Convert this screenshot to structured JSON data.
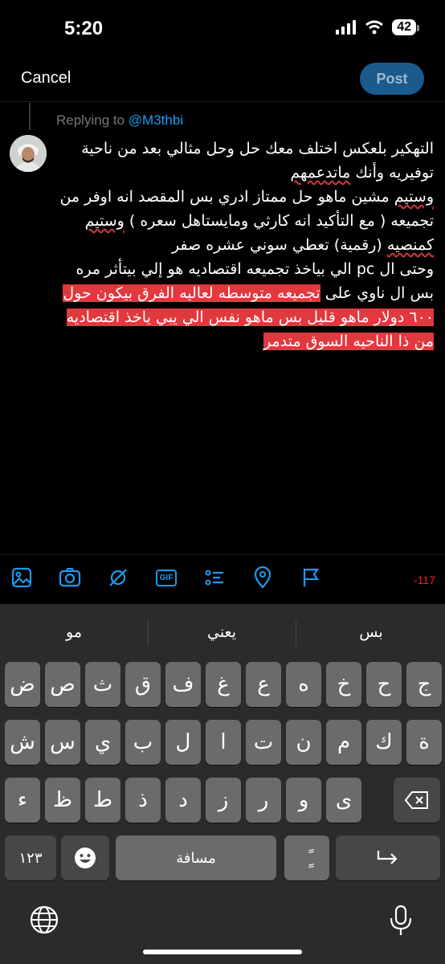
{
  "status": {
    "time": "5:20",
    "battery": "42"
  },
  "header": {
    "cancel_label": "Cancel",
    "post_label": "Post"
  },
  "reply": {
    "prefix": "Replying to",
    "handle": "@M3thbi"
  },
  "compose": {
    "p1": "التهكير بلعكس اختلف معك حل وحل مثالي بعد من ناحية توفيريه وأنك ",
    "p1_flag": "ماتدعمهم",
    "p2a_flag": "وستيم",
    "p2a": " مشين ماهو حل ممتاز ادري بس المقصد انه اوفر من تجميعه ( مع التأكيد انه كارثي ومايستاهل سعره ) ",
    "p2b_flag": "وستيم",
    "p2b_mid": " ",
    "p2c_flag": "كمنصيه",
    "p2c": " (رقمية) تعطي سوني عشره صفر",
    "p3_plain": "وحتى ال pc الي بياخذ تجميعه اقتصاديه هو إلي بيتأثر مره بس ال ناوي على ",
    "p3_highlight": "تجميعه متوسطه لعاليه الفرق بيكون حول ٦٠٠ دولار ماهو قليل بس ماهو نفس الي يبي ياخذ اقتصاديه من ذا الناحيه السوق متدمر"
  },
  "toolbar": {
    "icons": [
      "image-icon",
      "camera-icon",
      "grok-icon",
      "gif-icon",
      "poll-icon",
      "location-icon",
      "flag-icon"
    ],
    "gif_text": "GIF",
    "char_count": "-117"
  },
  "keyboard": {
    "suggestions": [
      "مو",
      "يعني",
      "بس"
    ],
    "row1": [
      "ض",
      "ص",
      "ث",
      "ق",
      "ف",
      "غ",
      "ع",
      "ه",
      "خ",
      "ح",
      "ج"
    ],
    "row2": [
      "ش",
      "س",
      "ي",
      "ب",
      "ل",
      "ا",
      "ت",
      "ن",
      "م",
      "ك",
      "ة"
    ],
    "row3": [
      "ء",
      "ظ",
      "ط",
      "ذ",
      "د",
      "ز",
      "ر",
      "و",
      "ى"
    ],
    "numbers_label": "١٢٣",
    "space_label": "مسافة",
    "diacritic_label": "ًٍ"
  },
  "colors": {
    "accent": "#1d9bf0",
    "highlight": "#e0393e",
    "keyboard_bg": "#2b2b2b"
  }
}
